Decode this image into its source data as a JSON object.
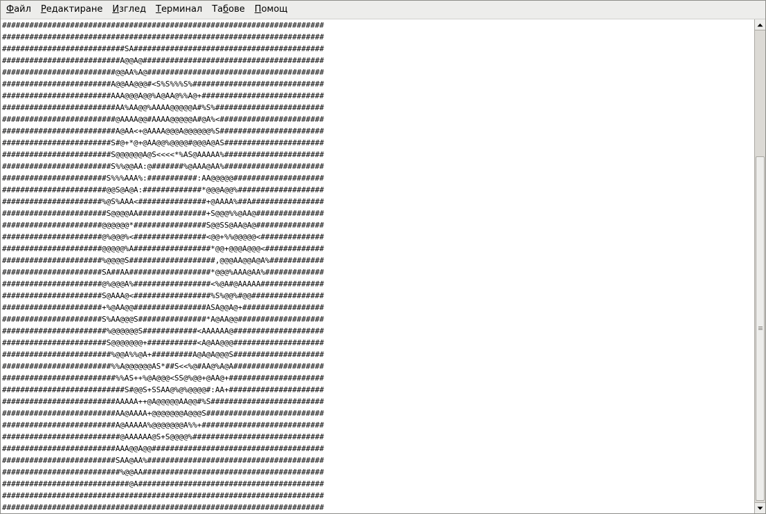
{
  "menubar": {
    "items": [
      {
        "mnemonic": "Ф",
        "rest": "айл"
      },
      {
        "mnemonic": "Р",
        "rest": "едактиране"
      },
      {
        "mnemonic": "И",
        "rest": "зглед"
      },
      {
        "mnemonic": "Т",
        "rest": "ерминал"
      },
      {
        "pre": "Та",
        "mnemonic": "б",
        "rest": "ове"
      },
      {
        "mnemonic": "П",
        "rest": "омощ"
      }
    ]
  },
  "terminal": {
    "lines": [
      "#######################################################################",
      "#######################################################################",
      "###########################SA##########################################",
      "##########################A@@A@########################################",
      "#########################@@AA%A@#######################################",
      "########################A@@AA@@@#<S%S%%%S%#############################",
      "########################AAA@@@A@@%A@AA@%%A@+###########################",
      "#########################AA%AA@@%AAAA@@@@@A#%S%########################",
      "#########################@AAAA@@#AAAA@@@@@A#@A%<#######################",
      "#########################A@AA<+@AAAA@@@A@@@@@@%S#######################",
      "########################S#@+*@+@AA@@%@@@@#@@@A@AS######################",
      "########################S@@@@@@A@S<<<<*%AS@AAAAA%######################",
      "########################S%%@@AA:@#######%@AAA@AA%######################",
      "#######################S%%%AAA%:###########:AA@@@@@####################",
      "#######################@@S@A@A:#############*@@@A@@%###################",
      "######################%@S%AAA<###############+@AAAA%##A################",
      "#######################S@@@@AA###############+S@@@%%@AA@###############",
      "######################@@@@@@*################S@@SS@AA@A@###############",
      "######################@%@@@%<################<@@+%%@@@@@<##############",
      "######################@@@@@%A#################*@@+@@@A@@@<#############",
      "######################%@@@@S###################,@@@AA@@A@A%############",
      "######################SA##AA##################*@@@%AAA@AA%#############",
      "######################@%@@@A%#################<%@A#@AAAAA##############",
      "######################S@AAA@<#################%S%@@%#@@################",
      "######################+%@AA@@################ASA@@A@+##################",
      "######################S%AA@@@S###############*A@AA@@###################",
      "#######################%@@@@@@S############<AAAAAA@####################",
      "#######################S@@@@@@@+###########<A@AA@@@####################",
      "########################%@@A%%@A+#########A@A@A@@@S####################",
      "########################%%A@@@@@@AS*##S<<%@#AA@%A@A####################",
      "#########################%%AS++%@A@@@<SS@%@@+@AA@+#####################",
      "###########################S#@@S+SSAA@%@%@@@@#:AA+#####################",
      "#########################AAAAA++@A@@@@@AA@@#%S#########################",
      "#########################AA@AAAA+@@@@@@@A@@@S##########################",
      "#########################A@AAAAA%@@@@@@@A%%+###########################",
      "##########################@AAAAAA@S+S@@@@%#############################",
      "#########################AAA@@A@@######################################",
      "#########################SAA@AA%#######################################",
      "##########################%@@AA########################################",
      "############################@A#########################################",
      "#######################################################################",
      "#######################################################################"
    ]
  },
  "colors": {
    "terminal_background": "#ffffff",
    "terminal_foreground": "#000000",
    "chrome": "#ededeb"
  }
}
